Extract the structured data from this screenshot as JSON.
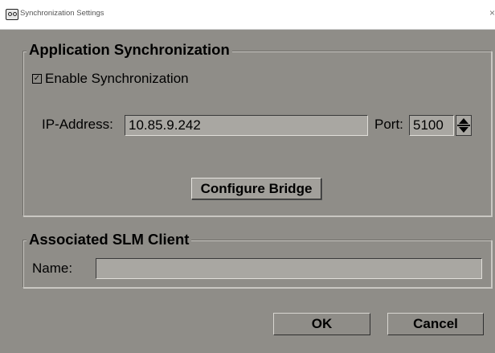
{
  "window": {
    "title": "Synchronization Settings",
    "close_symbol": "×",
    "icon": "app-icon"
  },
  "app_sync": {
    "title": "Application Synchronization",
    "enable_label": "Enable Synchronization",
    "enable_checked": true,
    "check_mark": "✓",
    "ip_label": "IP-Address:",
    "ip_value": "10.85.9.242",
    "port_label": "Port:",
    "port_value": "5100",
    "configure_button": "Configure Bridge"
  },
  "slm": {
    "title": "Associated SLM Client",
    "name_label": "Name:",
    "name_value": ""
  },
  "footer": {
    "ok_label": "OK",
    "cancel_label": "Cancel"
  },
  "colors": {
    "window_bg": "#8f8d88",
    "field_bg": "#a9a7a2"
  }
}
